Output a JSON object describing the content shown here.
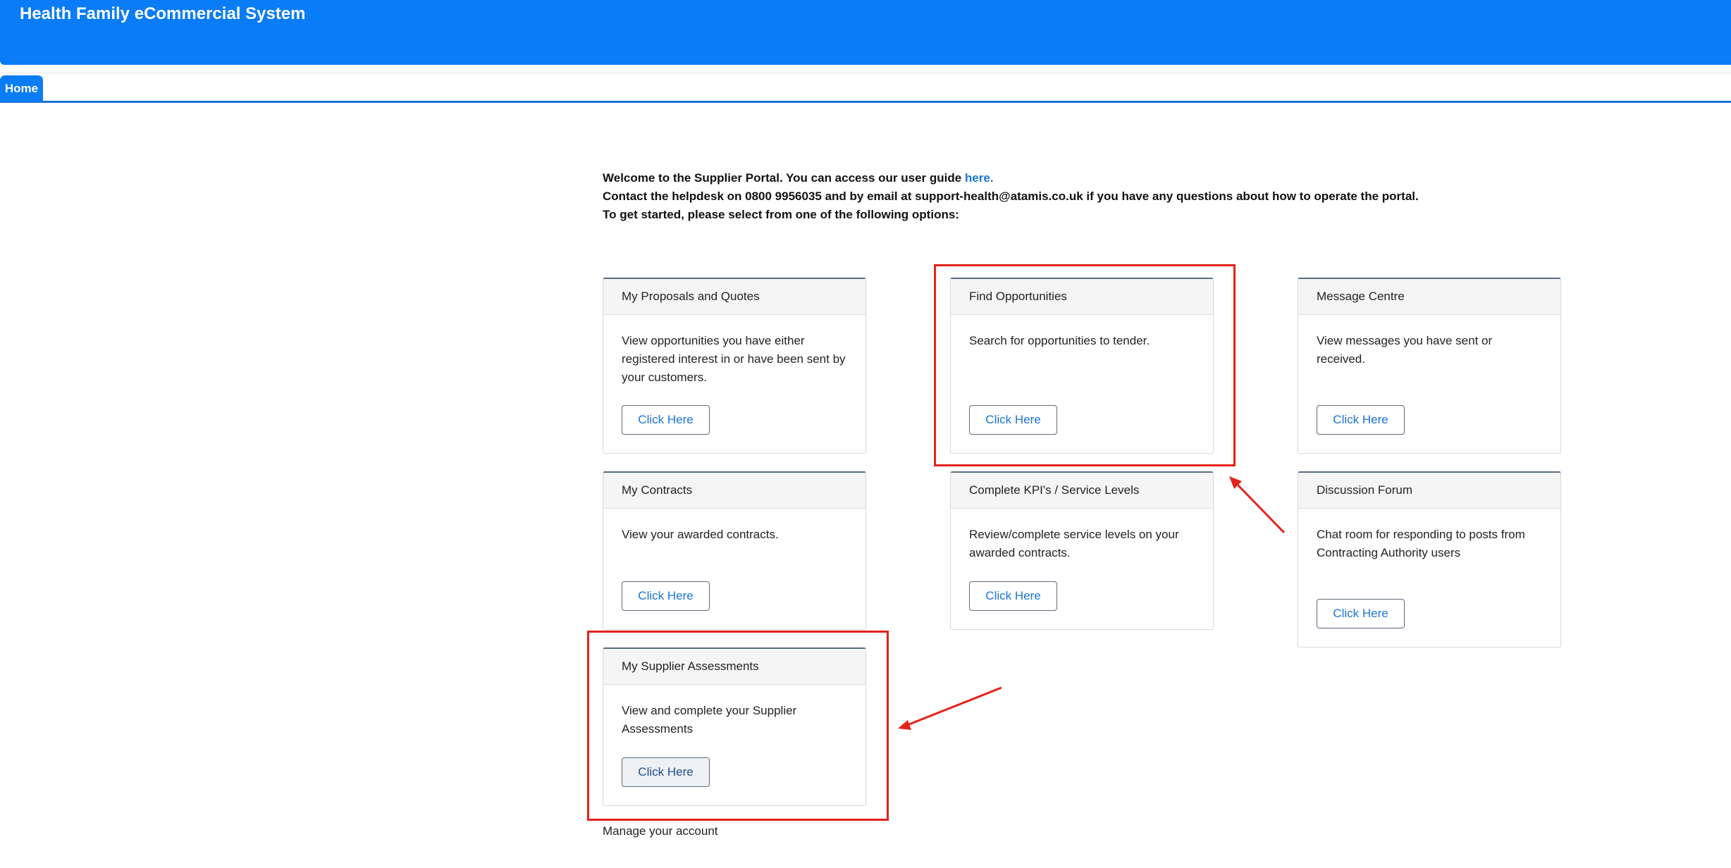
{
  "app": {
    "title": "Health Family eCommercial System"
  },
  "tabs": [
    {
      "label": "Home"
    }
  ],
  "intro": {
    "line1_prefix": "Welcome to the Supplier Portal. You can access our user guide ",
    "line1_link": "here",
    "line1_suffix": ".",
    "line2": "Contact the helpdesk on 0800 9956035 and by email at support-health@atamis.co.uk if you have any questions about how to operate the portal.",
    "line3": "To get started, please select from one of the following options:"
  },
  "cards": [
    {
      "title": "My Proposals and Quotes",
      "description": "View opportunities you have either registered interest in or have been sent by your customers.",
      "button": "Click Here"
    },
    {
      "title": "Find Opportunities",
      "description": "Search for opportunities to tender.",
      "button": "Click Here"
    },
    {
      "title": "Message Centre",
      "description": "View messages you have sent or received.",
      "button": "Click Here"
    },
    {
      "title": "My Contracts",
      "description": "View your awarded contracts.",
      "button": "Click Here"
    },
    {
      "title": "Complete KPI's / Service Levels",
      "description": "Review/complete service levels on your awarded contracts.",
      "button": "Click Here"
    },
    {
      "title": "Discussion Forum",
      "description": "Chat room for responding to posts from Contracting Authority users",
      "button": "Click Here"
    },
    {
      "title": "My Supplier Assessments",
      "description": "View and complete your Supplier Assessments",
      "button": "Click Here"
    }
  ],
  "footer": {
    "manage_account": "Manage your account"
  },
  "colors": {
    "header_blue": "#0a7cf7",
    "link_blue": "#1a74d6",
    "annotation_red": "#e3231a"
  }
}
